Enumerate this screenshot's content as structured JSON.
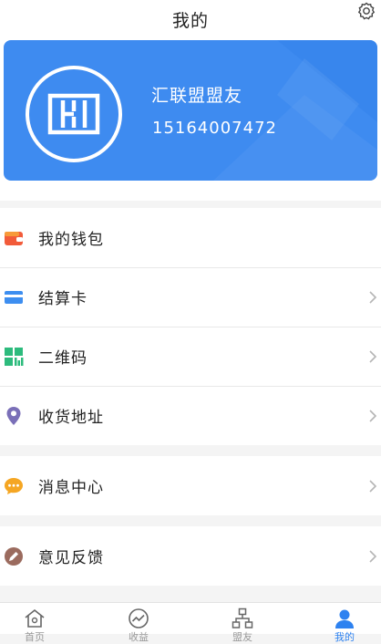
{
  "header": {
    "title": "我的"
  },
  "profile": {
    "name": "汇联盟盟友",
    "phone": "15164007472"
  },
  "menu": {
    "group1": [
      {
        "label": "我的钱包",
        "icon": "wallet-icon"
      },
      {
        "label": "结算卡",
        "icon": "card-icon"
      },
      {
        "label": "二维码",
        "icon": "qrcode-icon"
      },
      {
        "label": "收货地址",
        "icon": "location-icon"
      }
    ],
    "group2": [
      {
        "label": "消息中心",
        "icon": "message-icon"
      }
    ],
    "group3": [
      {
        "label": "意见反馈",
        "icon": "feedback-icon"
      }
    ]
  },
  "tabbar": [
    {
      "label": "首页",
      "icon": "home-icon"
    },
    {
      "label": "收益",
      "icon": "trend-icon"
    },
    {
      "label": "盟友",
      "icon": "network-icon"
    },
    {
      "label": "我的",
      "icon": "user-icon",
      "active": true
    }
  ],
  "colors": {
    "accent": "#3e8bf0",
    "tab_active": "#2e82f0"
  }
}
